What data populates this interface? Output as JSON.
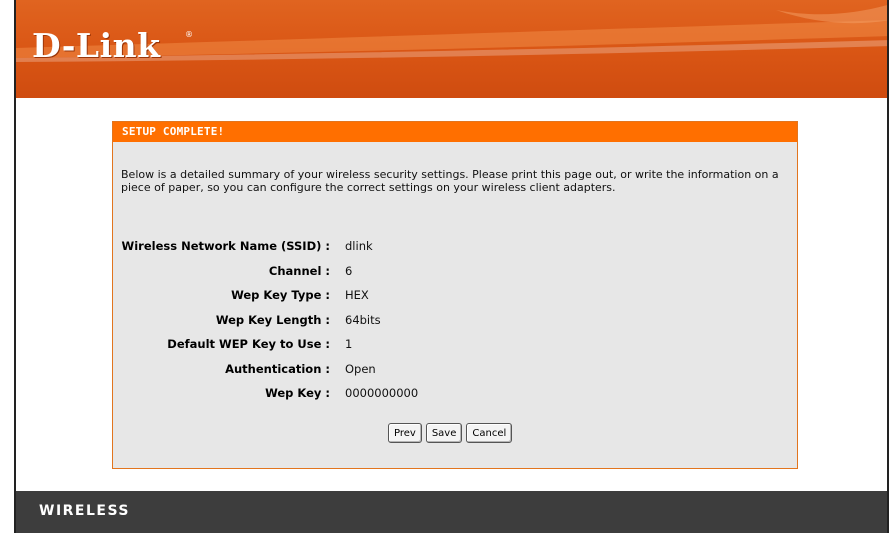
{
  "header": {
    "logo_text": "D-Link",
    "logo_reg": "®"
  },
  "panel": {
    "title": "SETUP COMPLETE!",
    "description": "Below is a detailed summary of your wireless security settings. Please print this page out, or write the information on a piece of paper, so you can configure the correct settings on your wireless client adapters.",
    "settings": [
      {
        "label": "Wireless Network Name (SSID) :",
        "value": "dlink"
      },
      {
        "label": "Channel :",
        "value": "6"
      },
      {
        "label": "Wep Key Type :",
        "value": "HEX"
      },
      {
        "label": "Wep Key Length :",
        "value": "64bits"
      },
      {
        "label": "Default WEP Key to Use :",
        "value": "1"
      },
      {
        "label": "Authentication :",
        "value": "Open"
      },
      {
        "label": "Wep Key :",
        "value": "0000000000"
      }
    ],
    "buttons": {
      "prev": "Prev",
      "save": "Save",
      "cancel": "Cancel"
    }
  },
  "footer": {
    "brand": "WIRELESS"
  },
  "colors": {
    "header_orange": "#d95514",
    "title_bar": "#ff6f00",
    "panel_bg": "#e7e7e7",
    "footer_bg": "#3d3d3d"
  },
  "icons": [
    "dlink-logo"
  ]
}
